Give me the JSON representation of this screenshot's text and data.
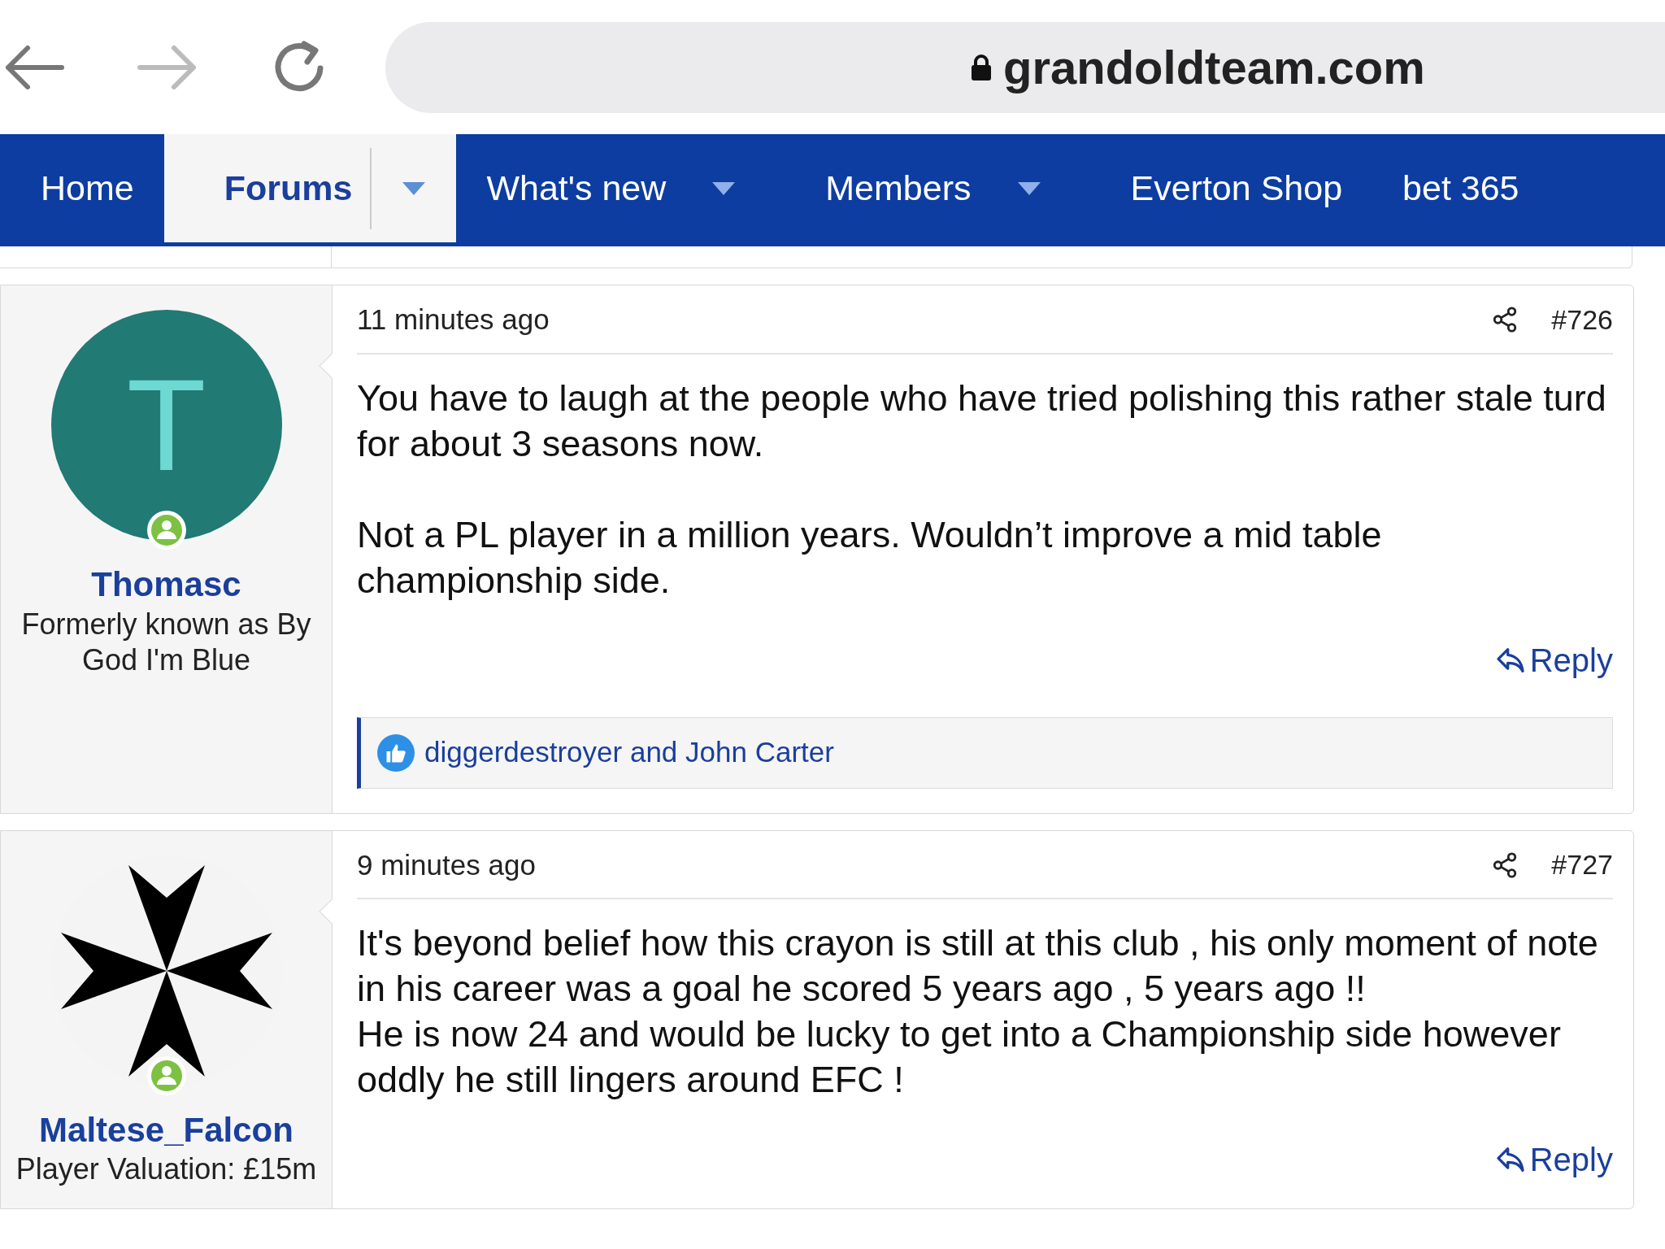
{
  "browser": {
    "url": "grandoldteam.com"
  },
  "nav": {
    "items": [
      {
        "label": "Home",
        "selected": false,
        "has_menu": false
      },
      {
        "label": "Forums",
        "selected": true,
        "has_menu": true
      },
      {
        "label": "What's new",
        "selected": false,
        "has_menu": true
      },
      {
        "label": "Members",
        "selected": false,
        "has_menu": true
      },
      {
        "label": "Everton Shop",
        "selected": false,
        "has_menu": false
      },
      {
        "label": "bet 365",
        "selected": false,
        "has_menu": false
      }
    ]
  },
  "posts": [
    {
      "user": {
        "name": "Thomasc",
        "title": "Formerly known as By God I'm Blue",
        "avatar": {
          "kind": "letter",
          "letter": "T"
        },
        "online": true
      },
      "time": "11 minutes ago",
      "number": "#726",
      "body": "You have to laugh at the people who have tried polishing this rather stale turd for about 3 seasons now.\n\nNot a PL player in a million years. Wouldn’t improve a mid table championship side.",
      "reply": "Reply",
      "reactions": "diggerdestroyer and John Carter"
    },
    {
      "user": {
        "name": "Maltese_Falcon",
        "title": "Player Valuation: £15m",
        "avatar": {
          "kind": "cross"
        },
        "online": true
      },
      "time": "9 minutes ago",
      "number": "#727",
      "body": "It's beyond belief how this crayon is still at this club , his only moment of note in his career was a goal he scored 5 years ago , 5 years ago !!\nHe is now 24 and would be lucky to get into a Championship side however oddly he still lingers around EFC !",
      "reply": "Reply"
    }
  ]
}
